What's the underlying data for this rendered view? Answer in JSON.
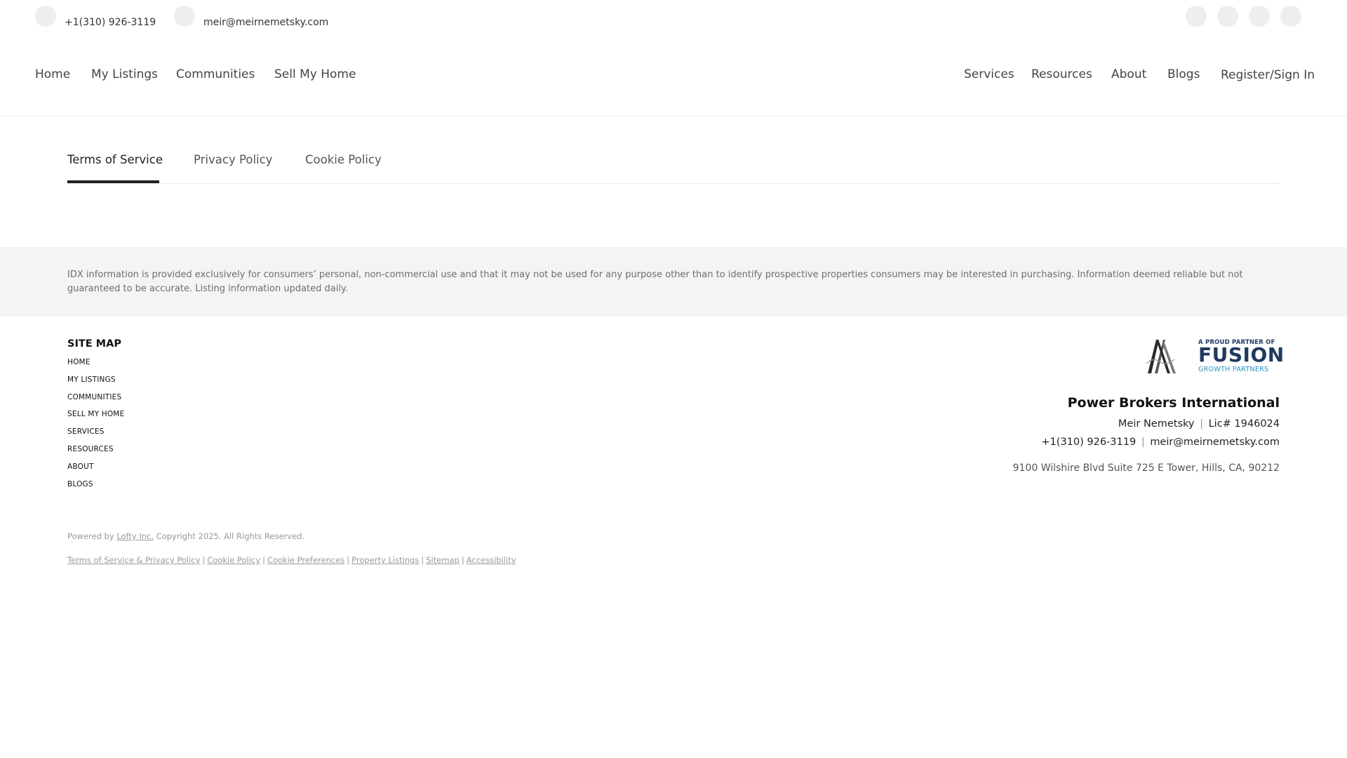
{
  "topbar": {
    "phone": "+1(310) 926-3119",
    "email": "meir@meirnemetsky.com",
    "social_icons": [
      "social-icon-1",
      "social-icon-2",
      "social-icon-3",
      "social-icon-4"
    ]
  },
  "nav": {
    "left": [
      "Home",
      "My Listings",
      "Communities",
      "Sell My Home"
    ],
    "right": [
      "Services",
      "Resources",
      "About",
      "Blogs"
    ],
    "register": "Register/Sign In"
  },
  "tabs": {
    "items": [
      "Terms of Service",
      "Privacy Policy",
      "Cookie Policy"
    ],
    "active": "Terms of Service"
  },
  "idx": {
    "text": "IDX information is provided exclusively for consumers’ personal, non-commercial use and that it may not be used for any purpose other than to identify prospective properties consumers may be interested in purchasing. Information deemed reliable but not guaranteed to be accurate. Listing information updated daily."
  },
  "sitemap": {
    "title": "SITE MAP",
    "items": [
      "HOME",
      "MY LISTINGS",
      "COMMUNITIES",
      "SELL MY HOME",
      "SERVICES",
      "RESOURCES",
      "ABOUT",
      "BLOGS"
    ]
  },
  "partner_logo": {
    "tagline": "A PROUD PARTNER OF",
    "name": "FUSION",
    "subtitle": "GROWTH PARTNERS"
  },
  "company": {
    "name": "Power Brokers International",
    "agent": "Meir Nemetsky",
    "license": "Lic# 1946024",
    "phone": "+1(310) 926-3119",
    "email": "meir@meirnemetsky.com",
    "address": "9100 Wilshire Blvd Suite 725 E Tower, Hills, CA, 90212",
    "separator": "|"
  },
  "footer": {
    "powered_prefix": "Powered by",
    "powered_link": "Lofty Inc.",
    "copyright": "Copyright 2025. All Rights Reserved.",
    "links": [
      "Terms of Service & Privacy Policy",
      "Cookie Policy",
      "Cookie Preferences",
      "Property Listings",
      "Sitemap",
      "Accessibility"
    ],
    "separator": "|"
  },
  "colors": {
    "accent": "#222222",
    "band": "#f4f4f4",
    "fusion_navy": "#1e3a5f",
    "fusion_blue": "#2e8fc4"
  }
}
